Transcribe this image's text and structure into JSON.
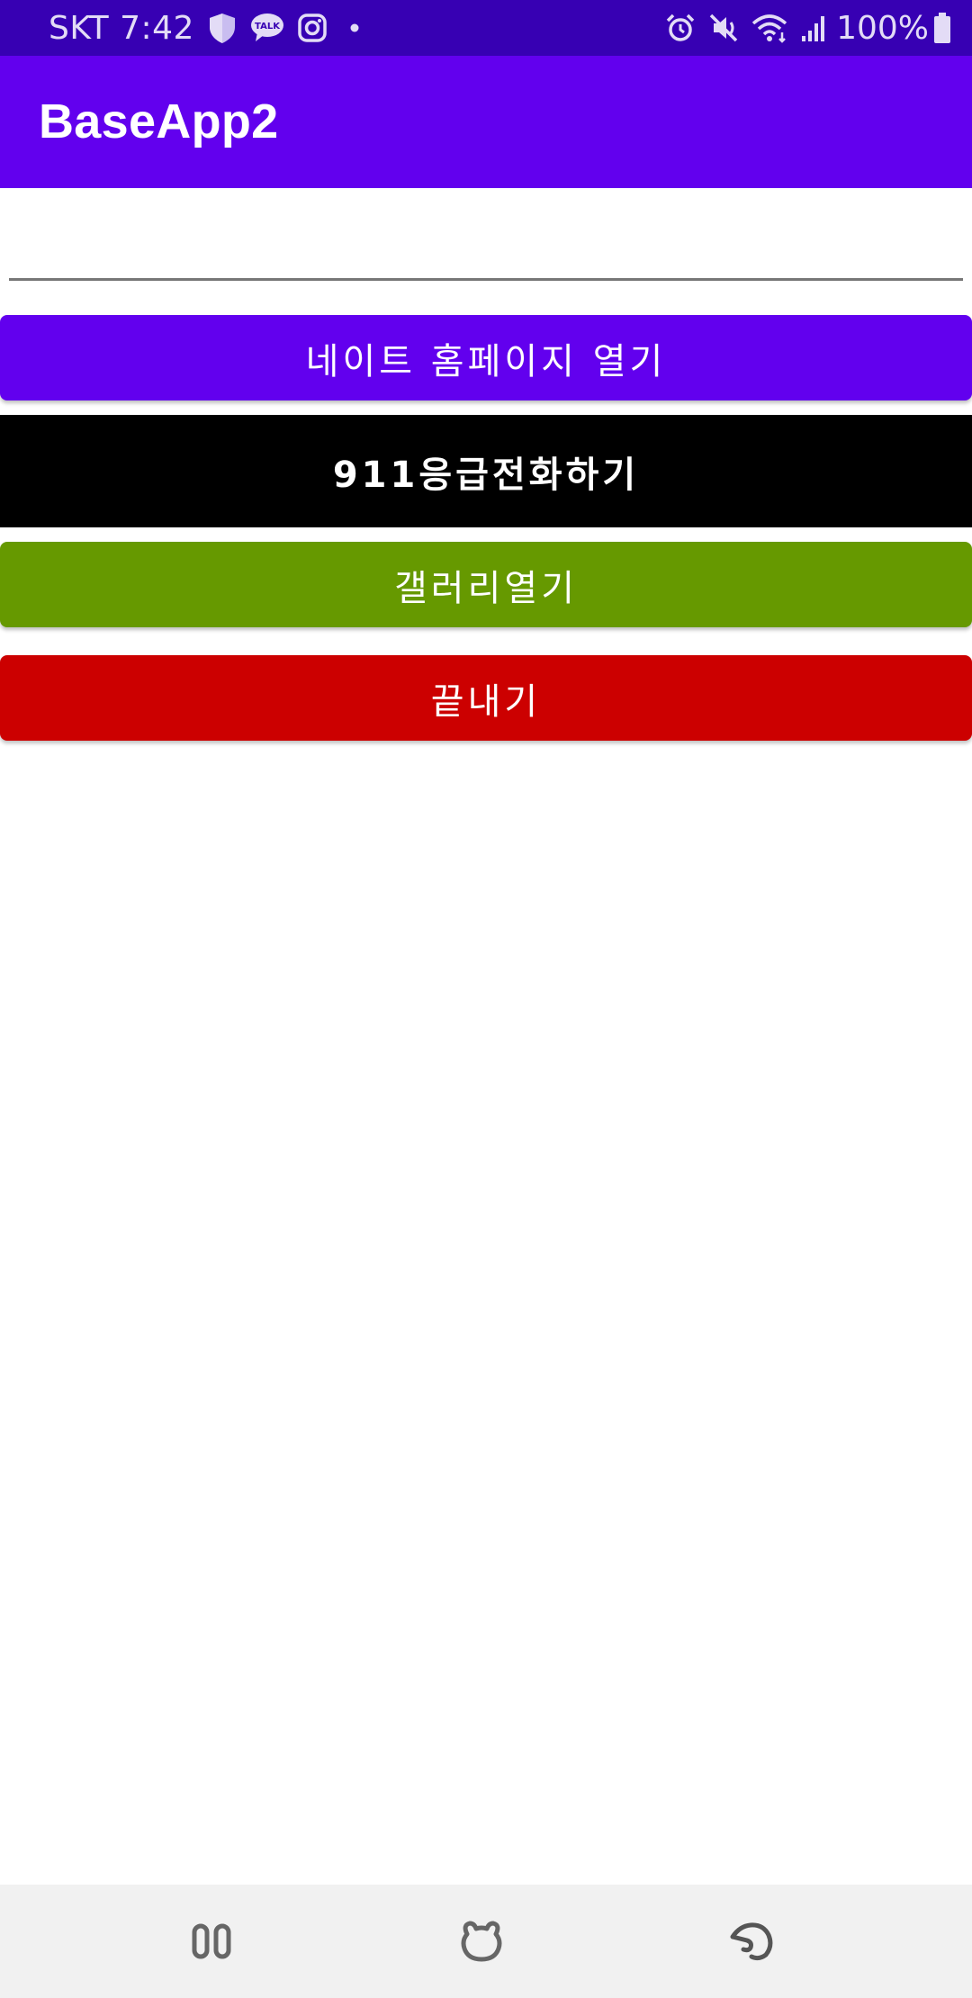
{
  "status_bar": {
    "carrier_time": "SKT 7:42",
    "talk_label": "TALK",
    "battery": "100%",
    "icons": [
      "shield-icon",
      "kakaotalk-icon",
      "instagram-icon",
      "dot-icon",
      "alarm-icon",
      "mute-icon",
      "wifi-icon",
      "signal-icon",
      "battery-icon"
    ]
  },
  "app_bar": {
    "title": "BaseApp2"
  },
  "input": {
    "value": "",
    "placeholder": ""
  },
  "buttons": {
    "nate": "네이트 홈페이지 열기",
    "call": "911응급전화하기",
    "gallery": "갤러리열기",
    "exit": "끝내기"
  },
  "colors": {
    "status_bar": "#3700b3",
    "app_bar": "#6200ee",
    "nate_button": "#6200ee",
    "call_button": "#000000",
    "gallery_button": "#669900",
    "exit_button": "#cc0000",
    "nav_bar": "#f1f1f1"
  },
  "nav_bar": {
    "icons": [
      "recent-apps-icon",
      "home-icon",
      "back-icon"
    ]
  }
}
